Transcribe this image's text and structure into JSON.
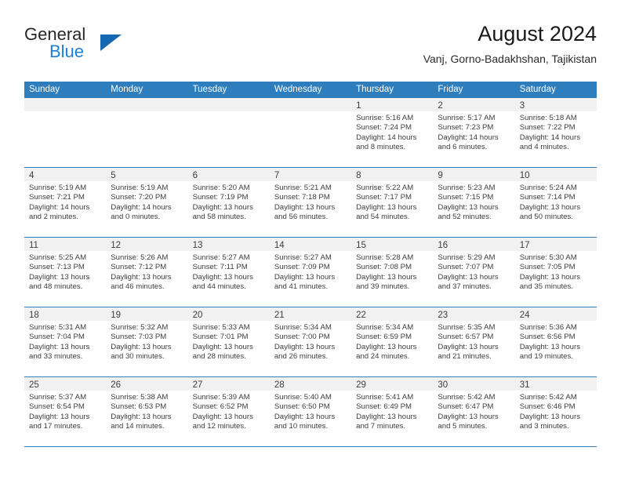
{
  "brand": {
    "name_part1": "General",
    "name_part2": "Blue",
    "triangle_icon": "triangle-icon",
    "accent_color": "#1668b3",
    "blue_text_color": "#1c7fd4"
  },
  "header": {
    "title": "August 2024",
    "subtitle": "Vanj, Gorno-Badakhshan, Tajikistan"
  },
  "calendar": {
    "header_bg": "#2e7ebd",
    "header_text_color": "#ffffff",
    "row_divider_color": "#2e7ebd",
    "date_strip_bg": "#f1f1f1",
    "weekdays": [
      "Sunday",
      "Monday",
      "Tuesday",
      "Wednesday",
      "Thursday",
      "Friday",
      "Saturday"
    ],
    "weeks": [
      [
        {
          "date": "",
          "lines": []
        },
        {
          "date": "",
          "lines": []
        },
        {
          "date": "",
          "lines": []
        },
        {
          "date": "",
          "lines": []
        },
        {
          "date": "1",
          "lines": [
            "Sunrise: 5:16 AM",
            "Sunset: 7:24 PM",
            "Daylight: 14 hours",
            "and 8 minutes."
          ]
        },
        {
          "date": "2",
          "lines": [
            "Sunrise: 5:17 AM",
            "Sunset: 7:23 PM",
            "Daylight: 14 hours",
            "and 6 minutes."
          ]
        },
        {
          "date": "3",
          "lines": [
            "Sunrise: 5:18 AM",
            "Sunset: 7:22 PM",
            "Daylight: 14 hours",
            "and 4 minutes."
          ]
        }
      ],
      [
        {
          "date": "4",
          "lines": [
            "Sunrise: 5:19 AM",
            "Sunset: 7:21 PM",
            "Daylight: 14 hours",
            "and 2 minutes."
          ]
        },
        {
          "date": "5",
          "lines": [
            "Sunrise: 5:19 AM",
            "Sunset: 7:20 PM",
            "Daylight: 14 hours",
            "and 0 minutes."
          ]
        },
        {
          "date": "6",
          "lines": [
            "Sunrise: 5:20 AM",
            "Sunset: 7:19 PM",
            "Daylight: 13 hours",
            "and 58 minutes."
          ]
        },
        {
          "date": "7",
          "lines": [
            "Sunrise: 5:21 AM",
            "Sunset: 7:18 PM",
            "Daylight: 13 hours",
            "and 56 minutes."
          ]
        },
        {
          "date": "8",
          "lines": [
            "Sunrise: 5:22 AM",
            "Sunset: 7:17 PM",
            "Daylight: 13 hours",
            "and 54 minutes."
          ]
        },
        {
          "date": "9",
          "lines": [
            "Sunrise: 5:23 AM",
            "Sunset: 7:15 PM",
            "Daylight: 13 hours",
            "and 52 minutes."
          ]
        },
        {
          "date": "10",
          "lines": [
            "Sunrise: 5:24 AM",
            "Sunset: 7:14 PM",
            "Daylight: 13 hours",
            "and 50 minutes."
          ]
        }
      ],
      [
        {
          "date": "11",
          "lines": [
            "Sunrise: 5:25 AM",
            "Sunset: 7:13 PM",
            "Daylight: 13 hours",
            "and 48 minutes."
          ]
        },
        {
          "date": "12",
          "lines": [
            "Sunrise: 5:26 AM",
            "Sunset: 7:12 PM",
            "Daylight: 13 hours",
            "and 46 minutes."
          ]
        },
        {
          "date": "13",
          "lines": [
            "Sunrise: 5:27 AM",
            "Sunset: 7:11 PM",
            "Daylight: 13 hours",
            "and 44 minutes."
          ]
        },
        {
          "date": "14",
          "lines": [
            "Sunrise: 5:27 AM",
            "Sunset: 7:09 PM",
            "Daylight: 13 hours",
            "and 41 minutes."
          ]
        },
        {
          "date": "15",
          "lines": [
            "Sunrise: 5:28 AM",
            "Sunset: 7:08 PM",
            "Daylight: 13 hours",
            "and 39 minutes."
          ]
        },
        {
          "date": "16",
          "lines": [
            "Sunrise: 5:29 AM",
            "Sunset: 7:07 PM",
            "Daylight: 13 hours",
            "and 37 minutes."
          ]
        },
        {
          "date": "17",
          "lines": [
            "Sunrise: 5:30 AM",
            "Sunset: 7:05 PM",
            "Daylight: 13 hours",
            "and 35 minutes."
          ]
        }
      ],
      [
        {
          "date": "18",
          "lines": [
            "Sunrise: 5:31 AM",
            "Sunset: 7:04 PM",
            "Daylight: 13 hours",
            "and 33 minutes."
          ]
        },
        {
          "date": "19",
          "lines": [
            "Sunrise: 5:32 AM",
            "Sunset: 7:03 PM",
            "Daylight: 13 hours",
            "and 30 minutes."
          ]
        },
        {
          "date": "20",
          "lines": [
            "Sunrise: 5:33 AM",
            "Sunset: 7:01 PM",
            "Daylight: 13 hours",
            "and 28 minutes."
          ]
        },
        {
          "date": "21",
          "lines": [
            "Sunrise: 5:34 AM",
            "Sunset: 7:00 PM",
            "Daylight: 13 hours",
            "and 26 minutes."
          ]
        },
        {
          "date": "22",
          "lines": [
            "Sunrise: 5:34 AM",
            "Sunset: 6:59 PM",
            "Daylight: 13 hours",
            "and 24 minutes."
          ]
        },
        {
          "date": "23",
          "lines": [
            "Sunrise: 5:35 AM",
            "Sunset: 6:57 PM",
            "Daylight: 13 hours",
            "and 21 minutes."
          ]
        },
        {
          "date": "24",
          "lines": [
            "Sunrise: 5:36 AM",
            "Sunset: 6:56 PM",
            "Daylight: 13 hours",
            "and 19 minutes."
          ]
        }
      ],
      [
        {
          "date": "25",
          "lines": [
            "Sunrise: 5:37 AM",
            "Sunset: 6:54 PM",
            "Daylight: 13 hours",
            "and 17 minutes."
          ]
        },
        {
          "date": "26",
          "lines": [
            "Sunrise: 5:38 AM",
            "Sunset: 6:53 PM",
            "Daylight: 13 hours",
            "and 14 minutes."
          ]
        },
        {
          "date": "27",
          "lines": [
            "Sunrise: 5:39 AM",
            "Sunset: 6:52 PM",
            "Daylight: 13 hours",
            "and 12 minutes."
          ]
        },
        {
          "date": "28",
          "lines": [
            "Sunrise: 5:40 AM",
            "Sunset: 6:50 PM",
            "Daylight: 13 hours",
            "and 10 minutes."
          ]
        },
        {
          "date": "29",
          "lines": [
            "Sunrise: 5:41 AM",
            "Sunset: 6:49 PM",
            "Daylight: 13 hours",
            "and 7 minutes."
          ]
        },
        {
          "date": "30",
          "lines": [
            "Sunrise: 5:42 AM",
            "Sunset: 6:47 PM",
            "Daylight: 13 hours",
            "and 5 minutes."
          ]
        },
        {
          "date": "31",
          "lines": [
            "Sunrise: 5:42 AM",
            "Sunset: 6:46 PM",
            "Daylight: 13 hours",
            "and 3 minutes."
          ]
        }
      ]
    ]
  }
}
